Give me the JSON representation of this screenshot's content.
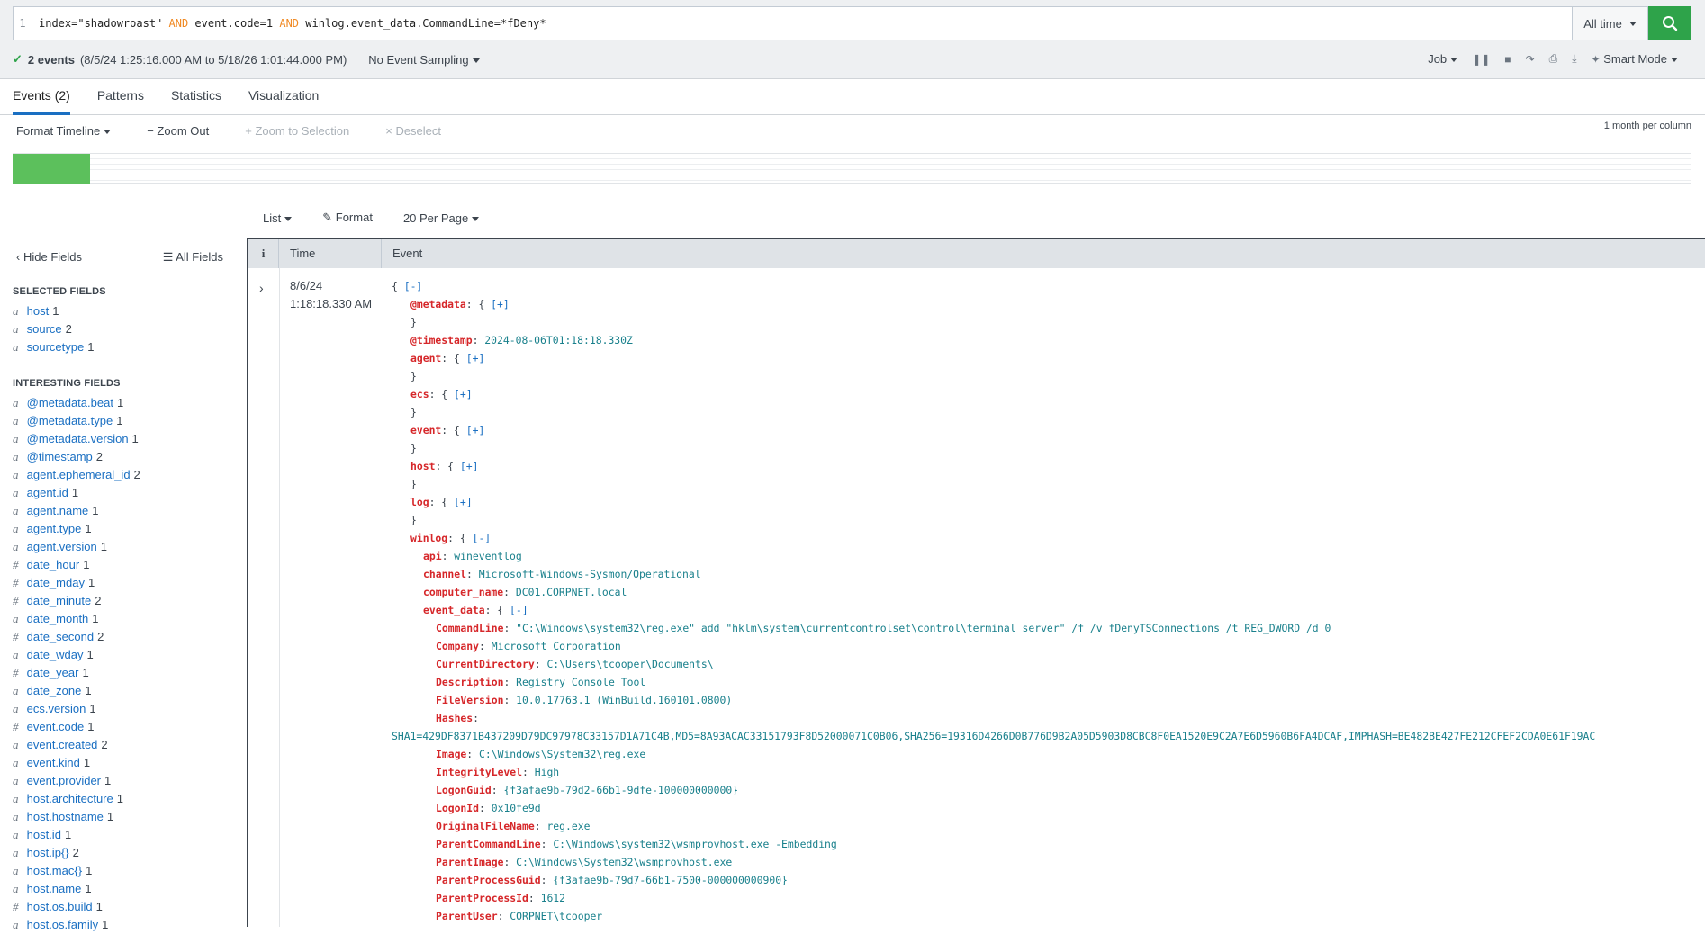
{
  "search": {
    "line_number": "1",
    "query_parts": [
      {
        "text": "index=\"shadowroast\" ",
        "kind": "plain"
      },
      {
        "text": "AND",
        "kind": "op"
      },
      {
        "text": " event.code=1 ",
        "kind": "plain"
      },
      {
        "text": "AND",
        "kind": "op"
      },
      {
        "text": " winlog.event_data.CommandLine=*fDeny*",
        "kind": "plain"
      }
    ],
    "time_range": "All time"
  },
  "status": {
    "events": "2 events",
    "range": "(8/5/24 1:25:16.000 AM to 5/18/26 1:01:44.000 PM)",
    "sampling": "No Event Sampling",
    "job": "Job",
    "mode": "Smart Mode"
  },
  "tabs": [
    "Events (2)",
    "Patterns",
    "Statistics",
    "Visualization"
  ],
  "timeline": {
    "format": "Format Timeline",
    "zoom_out": "Zoom Out",
    "zoom_selection": "Zoom to Selection",
    "deselect": "Deselect",
    "scale": "1 month per column"
  },
  "results_toolbar": {
    "list": "List",
    "format": "Format",
    "per_page": "20 Per Page"
  },
  "sidebar": {
    "hide_fields": "Hide Fields",
    "all_fields": "All Fields",
    "selected_title": "SELECTED FIELDS",
    "selected": [
      {
        "type": "a",
        "name": "host",
        "count": "1"
      },
      {
        "type": "a",
        "name": "source",
        "count": "2"
      },
      {
        "type": "a",
        "name": "sourcetype",
        "count": "1"
      }
    ],
    "interesting_title": "INTERESTING FIELDS",
    "interesting": [
      {
        "type": "a",
        "name": "@metadata.beat",
        "count": "1"
      },
      {
        "type": "a",
        "name": "@metadata.type",
        "count": "1"
      },
      {
        "type": "a",
        "name": "@metadata.version",
        "count": "1"
      },
      {
        "type": "a",
        "name": "@timestamp",
        "count": "2"
      },
      {
        "type": "a",
        "name": "agent.ephemeral_id",
        "count": "2"
      },
      {
        "type": "a",
        "name": "agent.id",
        "count": "1"
      },
      {
        "type": "a",
        "name": "agent.name",
        "count": "1"
      },
      {
        "type": "a",
        "name": "agent.type",
        "count": "1"
      },
      {
        "type": "a",
        "name": "agent.version",
        "count": "1"
      },
      {
        "type": "#",
        "name": "date_hour",
        "count": "1"
      },
      {
        "type": "#",
        "name": "date_mday",
        "count": "1"
      },
      {
        "type": "#",
        "name": "date_minute",
        "count": "2"
      },
      {
        "type": "a",
        "name": "date_month",
        "count": "1"
      },
      {
        "type": "#",
        "name": "date_second",
        "count": "2"
      },
      {
        "type": "a",
        "name": "date_wday",
        "count": "1"
      },
      {
        "type": "#",
        "name": "date_year",
        "count": "1"
      },
      {
        "type": "a",
        "name": "date_zone",
        "count": "1"
      },
      {
        "type": "a",
        "name": "ecs.version",
        "count": "1"
      },
      {
        "type": "#",
        "name": "event.code",
        "count": "1"
      },
      {
        "type": "a",
        "name": "event.created",
        "count": "2"
      },
      {
        "type": "a",
        "name": "event.kind",
        "count": "1"
      },
      {
        "type": "a",
        "name": "event.provider",
        "count": "1"
      },
      {
        "type": "a",
        "name": "host.architecture",
        "count": "1"
      },
      {
        "type": "a",
        "name": "host.hostname",
        "count": "1"
      },
      {
        "type": "a",
        "name": "host.id",
        "count": "1"
      },
      {
        "type": "a",
        "name": "host.ip{}",
        "count": "2"
      },
      {
        "type": "a",
        "name": "host.mac{}",
        "count": "1"
      },
      {
        "type": "a",
        "name": "host.name",
        "count": "1"
      },
      {
        "type": "#",
        "name": "host.os.build",
        "count": "1"
      },
      {
        "type": "a",
        "name": "host.os.family",
        "count": "1"
      }
    ]
  },
  "table": {
    "headers": {
      "info": "i",
      "time": "Time",
      "event": "Event"
    },
    "event": {
      "date": "8/6/24",
      "time": "1:18:18.330 AM",
      "lines": [
        {
          "indent": 0,
          "parts": [
            {
              "t": "{ ",
              "c": "p"
            },
            {
              "t": "[-]",
              "c": "br"
            }
          ]
        },
        {
          "indent": 1,
          "parts": [
            {
              "t": "@metadata",
              "c": "k"
            },
            {
              "t": ": { ",
              "c": "p"
            },
            {
              "t": "[+]",
              "c": "br"
            }
          ]
        },
        {
          "indent": 1,
          "parts": [
            {
              "t": "}",
              "c": "p"
            }
          ]
        },
        {
          "indent": 1,
          "parts": [
            {
              "t": "@timestamp",
              "c": "k"
            },
            {
              "t": ": ",
              "c": "p"
            },
            {
              "t": "2024-08-06T01:18:18.330Z",
              "c": "v"
            }
          ]
        },
        {
          "indent": 1,
          "parts": [
            {
              "t": "agent",
              "c": "k"
            },
            {
              "t": ": { ",
              "c": "p"
            },
            {
              "t": "[+]",
              "c": "br"
            }
          ]
        },
        {
          "indent": 1,
          "parts": [
            {
              "t": "}",
              "c": "p"
            }
          ]
        },
        {
          "indent": 1,
          "parts": [
            {
              "t": "ecs",
              "c": "k"
            },
            {
              "t": ": { ",
              "c": "p"
            },
            {
              "t": "[+]",
              "c": "br"
            }
          ]
        },
        {
          "indent": 1,
          "parts": [
            {
              "t": "}",
              "c": "p"
            }
          ]
        },
        {
          "indent": 1,
          "parts": [
            {
              "t": "event",
              "c": "k"
            },
            {
              "t": ": { ",
              "c": "p"
            },
            {
              "t": "[+]",
              "c": "br"
            }
          ]
        },
        {
          "indent": 1,
          "parts": [
            {
              "t": "}",
              "c": "p"
            }
          ]
        },
        {
          "indent": 1,
          "parts": [
            {
              "t": "host",
              "c": "k"
            },
            {
              "t": ": { ",
              "c": "p"
            },
            {
              "t": "[+]",
              "c": "br"
            }
          ]
        },
        {
          "indent": 1,
          "parts": [
            {
              "t": "}",
              "c": "p"
            }
          ]
        },
        {
          "indent": 1,
          "parts": [
            {
              "t": "log",
              "c": "k"
            },
            {
              "t": ": { ",
              "c": "p"
            },
            {
              "t": "[+]",
              "c": "br"
            }
          ]
        },
        {
          "indent": 1,
          "parts": [
            {
              "t": "}",
              "c": "p"
            }
          ]
        },
        {
          "indent": 1,
          "parts": [
            {
              "t": "winlog",
              "c": "k"
            },
            {
              "t": ": { ",
              "c": "p"
            },
            {
              "t": "[-]",
              "c": "br"
            }
          ]
        },
        {
          "indent": 2,
          "parts": [
            {
              "t": "api",
              "c": "k"
            },
            {
              "t": ": ",
              "c": "p"
            },
            {
              "t": "wineventlog",
              "c": "v"
            }
          ]
        },
        {
          "indent": 2,
          "parts": [
            {
              "t": "channel",
              "c": "k"
            },
            {
              "t": ": ",
              "c": "p"
            },
            {
              "t": "Microsoft-Windows-Sysmon/Operational",
              "c": "v"
            }
          ]
        },
        {
          "indent": 2,
          "parts": [
            {
              "t": "computer_name",
              "c": "k"
            },
            {
              "t": ": ",
              "c": "p"
            },
            {
              "t": "DC01.CORPNET.local",
              "c": "v"
            }
          ]
        },
        {
          "indent": 2,
          "parts": [
            {
              "t": "event_data",
              "c": "k"
            },
            {
              "t": ": { ",
              "c": "p"
            },
            {
              "t": "[-]",
              "c": "br"
            }
          ]
        },
        {
          "indent": 3,
          "parts": [
            {
              "t": "CommandLine",
              "c": "k"
            },
            {
              "t": ": ",
              "c": "p"
            },
            {
              "t": "\"C:\\Windows\\system32\\reg.exe\" add \"hklm\\system\\currentcontrolset\\control\\terminal server\" /f /v fDenyTSConnections /t REG_DWORD /d 0",
              "c": "v"
            }
          ]
        },
        {
          "indent": 3,
          "parts": [
            {
              "t": "Company",
              "c": "k"
            },
            {
              "t": ": ",
              "c": "p"
            },
            {
              "t": "Microsoft Corporation",
              "c": "v"
            }
          ]
        },
        {
          "indent": 3,
          "parts": [
            {
              "t": "CurrentDirectory",
              "c": "k"
            },
            {
              "t": ": ",
              "c": "p"
            },
            {
              "t": "C:\\Users\\tcooper\\Documents\\",
              "c": "v"
            }
          ]
        },
        {
          "indent": 3,
          "parts": [
            {
              "t": "Description",
              "c": "k"
            },
            {
              "t": ": ",
              "c": "p"
            },
            {
              "t": "Registry Console Tool",
              "c": "v"
            }
          ]
        },
        {
          "indent": 3,
          "parts": [
            {
              "t": "FileVersion",
              "c": "k"
            },
            {
              "t": ": ",
              "c": "p"
            },
            {
              "t": "10.0.17763.1 (WinBuild.160101.0800)",
              "c": "v"
            }
          ]
        },
        {
          "indent": 3,
          "parts": [
            {
              "t": "Hashes",
              "c": "k"
            },
            {
              "t": ":",
              "c": "p"
            }
          ]
        },
        {
          "indent": 0,
          "parts": [
            {
              "t": "SHA1=429DF8371B437209D79DC97978C33157D1A71C4B,MD5=8A93ACAC33151793F8D52000071C0B06,SHA256=19316D4266D0B776D9B2A05D5903D8CBC8F0EA1520E9C2A7E6D5960B6FA4DCAF,IMPHASH=BE482BE427FE212CFEF2CDA0E61F19AC",
              "c": "v"
            }
          ]
        },
        {
          "indent": 3,
          "parts": [
            {
              "t": "Image",
              "c": "k"
            },
            {
              "t": ": ",
              "c": "p"
            },
            {
              "t": "C:\\Windows\\System32\\reg.exe",
              "c": "v"
            }
          ]
        },
        {
          "indent": 3,
          "parts": [
            {
              "t": "IntegrityLevel",
              "c": "k"
            },
            {
              "t": ": ",
              "c": "p"
            },
            {
              "t": "High",
              "c": "v"
            }
          ]
        },
        {
          "indent": 3,
          "parts": [
            {
              "t": "LogonGuid",
              "c": "k"
            },
            {
              "t": ": ",
              "c": "p"
            },
            {
              "t": "{f3afae9b-79d2-66b1-9dfe-100000000000}",
              "c": "v"
            }
          ]
        },
        {
          "indent": 3,
          "parts": [
            {
              "t": "LogonId",
              "c": "k"
            },
            {
              "t": ": ",
              "c": "p"
            },
            {
              "t": "0x10fe9d",
              "c": "v"
            }
          ]
        },
        {
          "indent": 3,
          "parts": [
            {
              "t": "OriginalFileName",
              "c": "k"
            },
            {
              "t": ": ",
              "c": "p"
            },
            {
              "t": "reg.exe",
              "c": "v"
            }
          ]
        },
        {
          "indent": 3,
          "parts": [
            {
              "t": "ParentCommandLine",
              "c": "k"
            },
            {
              "t": ": ",
              "c": "p"
            },
            {
              "t": "C:\\Windows\\system32\\wsmprovhost.exe -Embedding",
              "c": "v"
            }
          ]
        },
        {
          "indent": 3,
          "parts": [
            {
              "t": "ParentImage",
              "c": "k"
            },
            {
              "t": ": ",
              "c": "p"
            },
            {
              "t": "C:\\Windows\\System32\\wsmprovhost.exe",
              "c": "v"
            }
          ]
        },
        {
          "indent": 3,
          "parts": [
            {
              "t": "ParentProcessGuid",
              "c": "k"
            },
            {
              "t": ": ",
              "c": "p"
            },
            {
              "t": "{f3afae9b-79d7-66b1-7500-000000000900}",
              "c": "v"
            }
          ]
        },
        {
          "indent": 3,
          "parts": [
            {
              "t": "ParentProcessId",
              "c": "k"
            },
            {
              "t": ": ",
              "c": "p"
            },
            {
              "t": "1612",
              "c": "v"
            }
          ]
        },
        {
          "indent": 3,
          "parts": [
            {
              "t": "ParentUser",
              "c": "k"
            },
            {
              "t": ": ",
              "c": "p"
            },
            {
              "t": "CORPNET\\tcooper",
              "c": "v"
            }
          ]
        }
      ]
    }
  }
}
